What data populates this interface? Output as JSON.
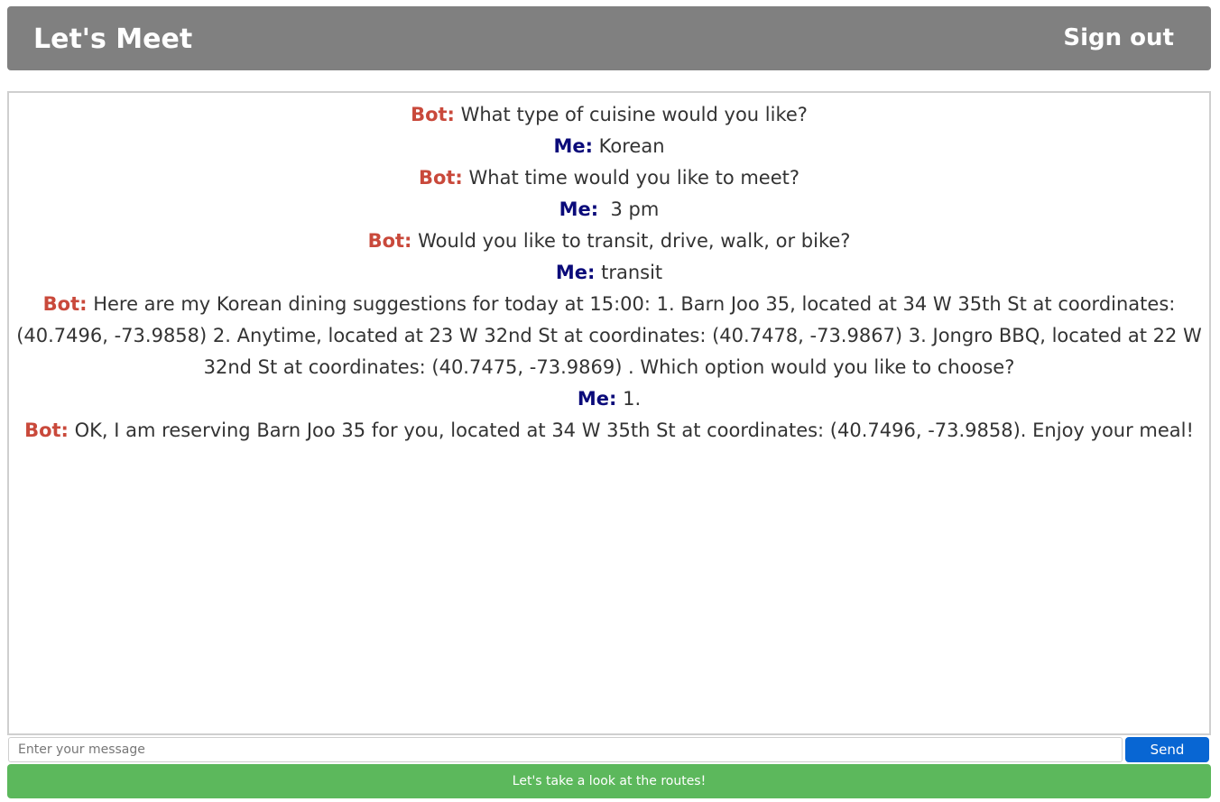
{
  "header": {
    "title": "Let's Meet",
    "signout_label": "Sign out"
  },
  "colors": {
    "header_bg": "#808080",
    "bot_label": "#c9493b",
    "me_label": "#0b0b7a",
    "send_button": "#0866d3",
    "routes_button": "#5cb85c"
  },
  "chat": {
    "messages": [
      {
        "sender": "Bot:",
        "role": "bot",
        "text": " What type of cuisine would you like?"
      },
      {
        "sender": "Me:",
        "role": "me",
        "text": " Korean"
      },
      {
        "sender": "Bot:",
        "role": "bot",
        "text": " What time would you like to meet?"
      },
      {
        "sender": "Me:",
        "role": "me",
        "text": "  3 pm"
      },
      {
        "sender": "Bot:",
        "role": "bot",
        "text": " Would you like to transit, drive, walk, or bike?"
      },
      {
        "sender": "Me:",
        "role": "me",
        "text": " transit"
      },
      {
        "sender": "Bot:",
        "role": "bot",
        "text": " Here are my Korean dining suggestions for today at 15:00: 1. Barn Joo 35, located at 34 W 35th St at coordinates: (40.7496, -73.9858) 2. Anytime, located at 23 W 32nd St at coordinates: (40.7478, -73.9867) 3. Jongro BBQ, located at 22 W 32nd St at coordinates: (40.7475, -73.9869) . Which option would you like to choose?"
      },
      {
        "sender": "Me:",
        "role": "me",
        "text": " 1."
      },
      {
        "sender": "Bot:",
        "role": "bot",
        "text": " OK, I am reserving Barn Joo 35 for you, located at 34 W 35th St at coordinates: (40.7496, -73.9858). Enjoy your meal!"
      }
    ]
  },
  "composer": {
    "value": "",
    "placeholder": "Enter your message",
    "send_label": "Send"
  },
  "routes_button_label": "Let's take a look at the routes!"
}
